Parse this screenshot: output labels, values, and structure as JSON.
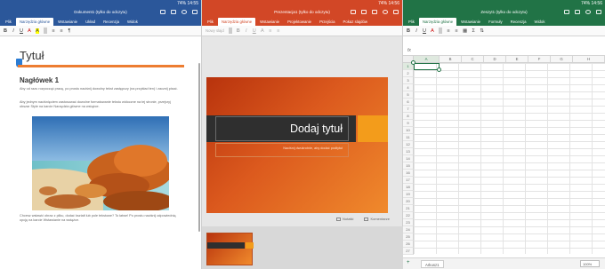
{
  "word": {
    "status": "74% 14:55",
    "doc_title": "Dokument1 (tylko do odczytu)",
    "tabs": [
      "Plik",
      "Narzędzia główne",
      "Wstawianie",
      "Układ",
      "Recenzja",
      "Widok"
    ],
    "active_tab": 1,
    "toolbar": [
      "B",
      "I",
      "U",
      "A",
      "A",
      "≡",
      "≡",
      "¶"
    ],
    "title": "Tytuł",
    "heading1": "Nagłówek 1",
    "para1": "Aby od razu rozpocząć pracę, po prostu naciśnij dowolny tekst zastępczy (na przykład ten) i zacznij pisać.",
    "para2": "Aby jednym naciśnięciem zastosować dowolne formatowanie tekstu widoczne na tej stronie, przejrzyj obszar Style na karcie Narzędzia główne na wstążce.",
    "para3": "Chcesz wstawić obraz z pliku, dodać kształt lub pole tekstowe? To łatwe! Po prostu naciśnij odpowiednią opcję na karcie Wstawianie na wstążce.",
    "accent": "#2b579a"
  },
  "ppt": {
    "status": "74% 14:56",
    "doc_title": "Prezentacja1 (tylko do odczytu)",
    "tabs": [
      "Plik",
      "Narzędzia główne",
      "Wstawianie",
      "Projektowanie",
      "Przejścia",
      "Pokaz slajdów"
    ],
    "active_tab": 1,
    "toolbar": [
      "Nowy slajd",
      "B",
      "I",
      "U",
      "A",
      "≡",
      "≡"
    ],
    "slide_title": "Dodaj tytuł",
    "slide_subtitle": "Naciśnij dwukrotnie, aby dodać podtytuł",
    "notes_label": "Notatki",
    "comments_label": "Komentarze",
    "accent": "#d24726"
  },
  "excel": {
    "status": "74% 14:56",
    "doc_title": "Zeszyt1 (tylko do odczytu)",
    "tabs": [
      "Plik",
      "Narzędzia główne",
      "Wstawianie",
      "Formuły",
      "Recenzja",
      "Widok"
    ],
    "active_tab": 1,
    "toolbar": [
      "B",
      "I",
      "U",
      "A",
      "≡",
      "≡",
      "▦",
      "Σ",
      "⇅"
    ],
    "fx": "fx",
    "columns": [
      "A",
      "B",
      "C",
      "D",
      "E",
      "F",
      "G",
      "H"
    ],
    "rows": [
      "1",
      "2",
      "3",
      "4",
      "5",
      "6",
      "7",
      "8",
      "9",
      "10",
      "11",
      "12",
      "13",
      "14",
      "15",
      "16",
      "17",
      "18",
      "19",
      "20",
      "21",
      "22",
      "23",
      "24",
      "25",
      "26",
      "27"
    ],
    "sheet_name": "Arkusz1",
    "zoom": "100%",
    "accent": "#217346"
  }
}
